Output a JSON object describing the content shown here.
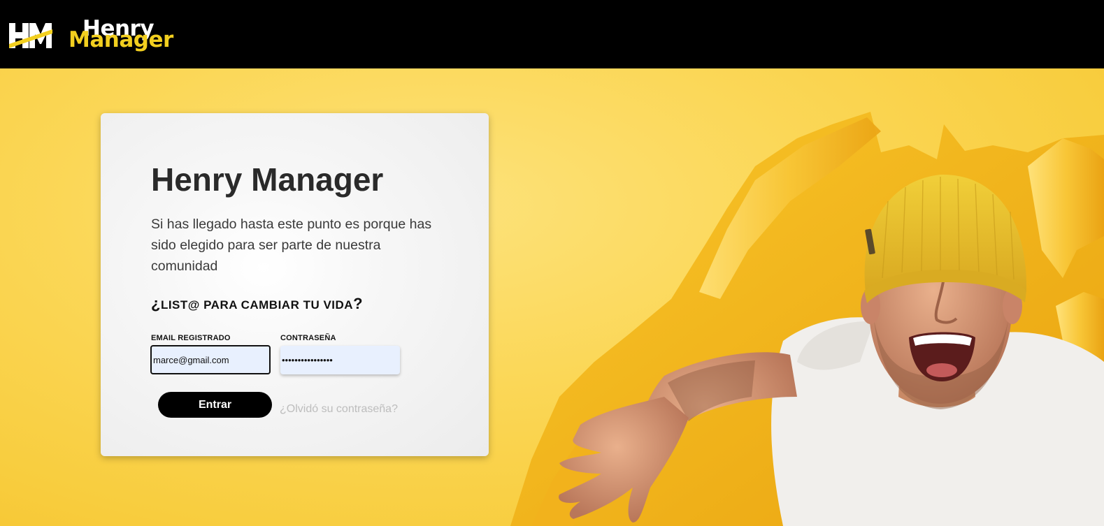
{
  "navbar": {
    "logo_icon": "hm-logo-icon",
    "brand_line1": "Henry",
    "brand_line2": "Manager",
    "brand_color": "#f2cf1f"
  },
  "hero": {
    "background_color": "#fbd757",
    "image": "excited-man-in-yellow-beanie-tearing-through-yellow-paper"
  },
  "login_card": {
    "title": "Henry Manager",
    "description": "Si has llegado hasta este punto es porque has sido elegido para ser parte de nuestra comunidad",
    "question_open": "¿",
    "question_text": "LIST@ PARA CAMBIAR TU VIDA",
    "question_close": "?",
    "email_label": "EMAIL REGISTRADO",
    "email_value": "marce@gmail.com",
    "password_label": "CONTRASEÑA",
    "password_value": "••••••••••••••••",
    "submit_label": "Entrar",
    "forgot_label": "¿Olvidó su contraseña?"
  }
}
